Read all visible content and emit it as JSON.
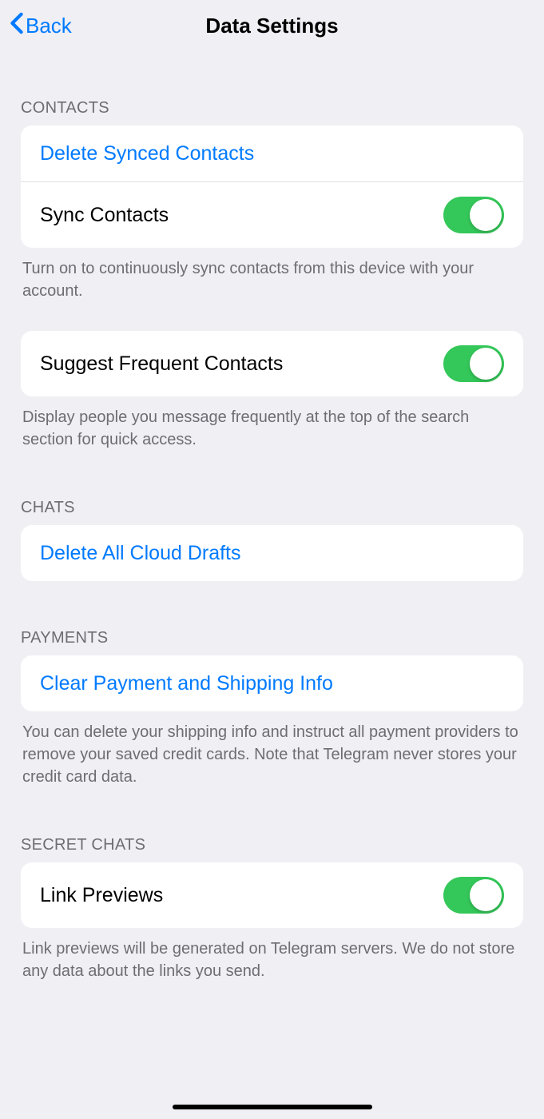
{
  "header": {
    "back_label": "Back",
    "title": "Data Settings"
  },
  "sections": {
    "contacts": {
      "header": "CONTACTS",
      "delete_synced": "Delete Synced Contacts",
      "sync_contacts": "Sync Contacts",
      "sync_footer": "Turn on to continuously sync contacts from this device with your account.",
      "suggest_frequent": "Suggest Frequent Contacts",
      "suggest_footer": "Display people you message frequently at the top of the search section for quick access."
    },
    "chats": {
      "header": "CHATS",
      "delete_drafts": "Delete All Cloud Drafts"
    },
    "payments": {
      "header": "PAYMENTS",
      "clear_info": "Clear Payment and Shipping Info",
      "footer": "You can delete your shipping info and instruct all payment providers to remove your saved credit cards. Note that Telegram never stores your credit card data."
    },
    "secret_chats": {
      "header": "SECRET CHATS",
      "link_previews": "Link Previews",
      "footer": "Link previews will be generated on Telegram servers. We do not store any data about the links you send."
    }
  },
  "toggles": {
    "sync_contacts": true,
    "suggest_frequent": true,
    "link_previews": true
  }
}
